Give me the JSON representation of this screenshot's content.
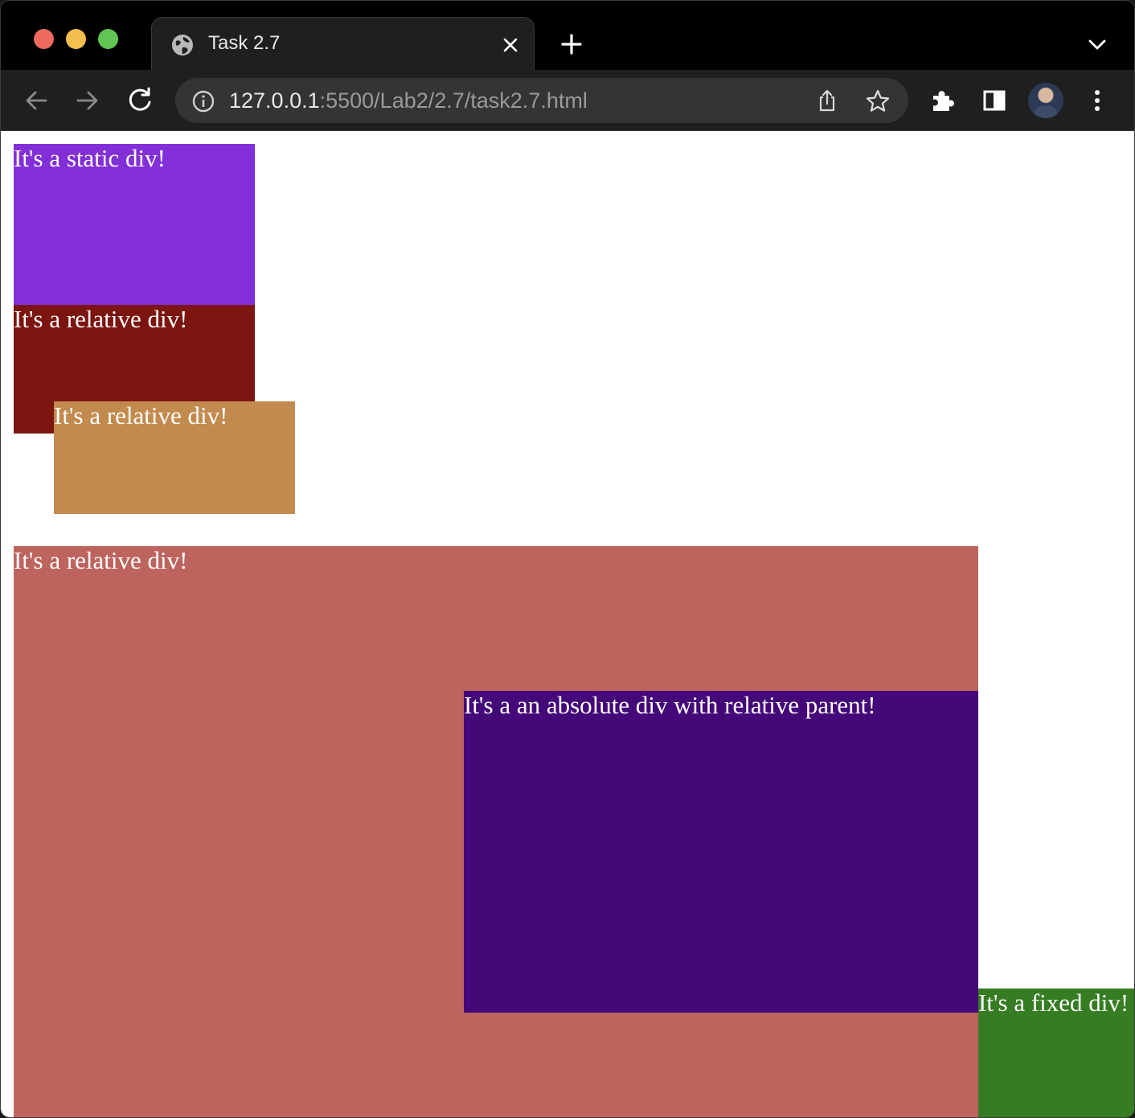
{
  "browser": {
    "tab_title": "Task 2.7",
    "url_host": "127.0.0.1",
    "url_rest": ":5500/Lab2/2.7/task2.7.html"
  },
  "page": {
    "static_div": "It's a static div!",
    "relative_div_1": "It's a relative div!",
    "relative_div_2": "It's a relative div!",
    "relative_parent": "It's a relative div!",
    "absolute_child": "It's a an absolute div with relative parent!",
    "fixed_div": "It's a fixed div!"
  },
  "colors": {
    "static_div": "#832fd8",
    "relative_div_1": "#7c150f",
    "relative_div_2": "#c38a4d",
    "relative_parent": "#be645e",
    "absolute_child": "#440879",
    "fixed_div": "#357c22"
  },
  "icons": {
    "tab_favicon": "globe-icon",
    "tab_close": "close-icon",
    "new_tab": "plus-icon",
    "tab_search": "chevron-down-icon",
    "back": "arrow-left-icon",
    "forward": "arrow-right-icon",
    "reload": "reload-icon",
    "site_info": "info-icon",
    "share": "share-icon",
    "bookmark": "star-icon",
    "extensions": "puzzle-icon",
    "side_panel": "side-panel-icon",
    "profile": "avatar",
    "menu": "kebab-menu-icon"
  }
}
